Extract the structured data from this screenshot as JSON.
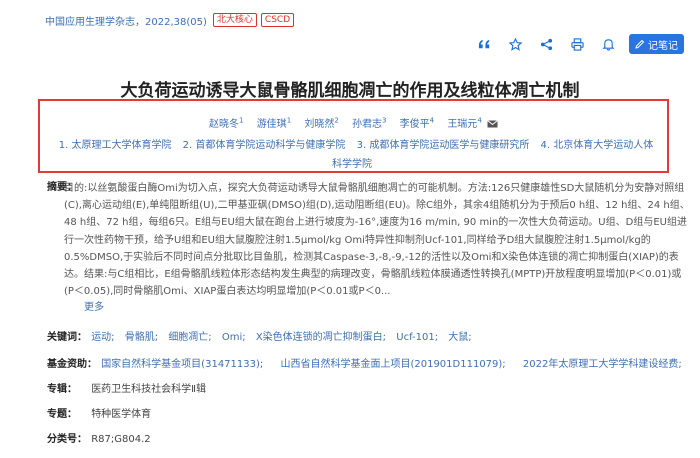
{
  "journal": "中国应用生理学杂志，2022,38(05)",
  "badges": [
    "北大核心",
    "CSCD"
  ],
  "toolbar": {
    "note_label": "记笔记"
  },
  "title": "大负荷运动诱导大鼠骨骼肌细胞凋亡的作用及线粒体凋亡机制",
  "authors": [
    {
      "name": "赵晓冬",
      "sup": "1"
    },
    {
      "name": "游佳琪",
      "sup": "1"
    },
    {
      "name": "刘晓然",
      "sup": "2"
    },
    {
      "name": "孙君志",
      "sup": "3"
    },
    {
      "name": "李俊平",
      "sup": "4"
    },
    {
      "name": "王瑞元",
      "sup": "4"
    }
  ],
  "affiliations": [
    "1. 太原理工大学体育学院",
    "2. 首都体育学院运动科学与健康学院",
    "3. 成都体育学院运动医学与健康研究所",
    "4. 北京体育大学运动人体科学学院"
  ],
  "abstract": {
    "label": "摘要：",
    "text": "目的:以丝氨酸蛋白酶Omi为切入点，探究大负荷运动诱导大鼠骨骼肌细胞凋亡的可能机制。方法:126只健康雄性SD大鼠随机分为安静对照组(C),离心运动组(E),单纯阻断组(U),二甲基亚砜(DMSO)组(D),运动阻断组(EU)。除C组外，其余4组随机分为于预后0 h组、12 h组、24 h组、48 h组、72 h组，每组6只。E组与EU组大鼠在跑台上进行坡度为-16°,速度为16 m/min, 90 min的一次性大负荷运动。U组、D组与EU组进行一次性药物干预，给予U组和EU组大鼠腹腔注射1.5μmol/kg Omi特异性抑制剂Ucf-101,同样给予D组大鼠腹腔注射1.5μmol/kg的0.5%DMSO,于实验后不同时间点分批取比目鱼肌，检测其Caspase-3,-8,-9,-12的活性以及Omi和X染色体连锁的凋亡抑制蛋白(XIAP)的表达。结果:与C组相比，E组骨骼肌线粒体形态结构发生典型的病理改变，骨骼肌线粒体膜通透性转换孔(MPTP)开放程度明显增加(P＜0.01)或(P＜0.05),同时骨骼肌Omi、XIAP蛋白表达均明显增加(P＜0.01或P＜0...",
    "more": "更多"
  },
  "keywords": {
    "label": "关键词：",
    "items": [
      "运动;",
      "骨骼肌;",
      "细胞凋亡;",
      "Omi;",
      "X染色体连锁的凋亡抑制蛋白;",
      "Ucf-101;",
      "大鼠;"
    ]
  },
  "funding": {
    "label": "基金资助：",
    "items": [
      "国家自然科学基金项目(31471133);",
      "山西省自然科学基金面上项目(201901D111079);",
      "2022年太原理工大学学科建设经费;"
    ]
  },
  "series": {
    "label": "专辑：",
    "value": "医药卫生科技社会科学Ⅱ辑"
  },
  "topic": {
    "label": "专题：",
    "value": "特种医学体育"
  },
  "classification": {
    "label": "分类号：",
    "value": "R87;G804.2"
  },
  "colors": {
    "link": "#3e6fb5",
    "badge": "#d9342b",
    "highlight_box": "#e53935",
    "note_button": "#2a74e0"
  },
  "icons": [
    "quote-icon",
    "star-icon",
    "share-icon",
    "print-icon",
    "bell-icon",
    "pencil-icon",
    "mail-icon"
  ]
}
